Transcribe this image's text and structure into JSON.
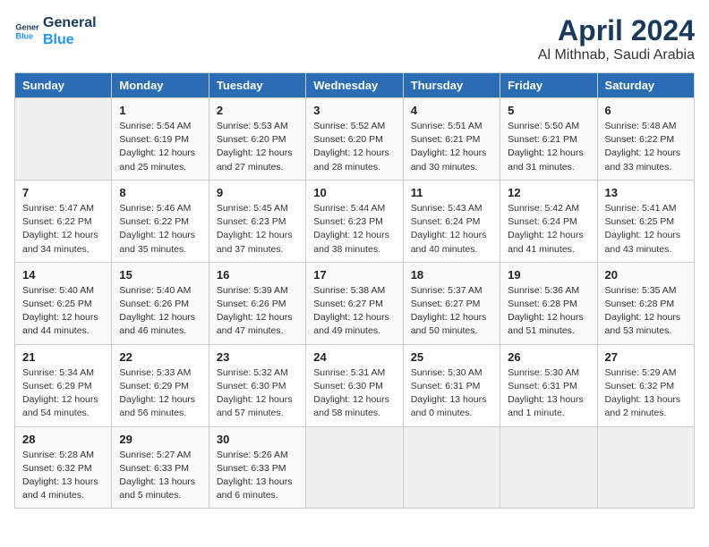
{
  "logo": {
    "line1": "General",
    "line2": "Blue"
  },
  "title": "April 2024",
  "subtitle": "Al Mithnab, Saudi Arabia",
  "headers": [
    "Sunday",
    "Monday",
    "Tuesday",
    "Wednesday",
    "Thursday",
    "Friday",
    "Saturday"
  ],
  "weeks": [
    [
      {
        "day": "",
        "info": ""
      },
      {
        "day": "1",
        "info": "Sunrise: 5:54 AM\nSunset: 6:19 PM\nDaylight: 12 hours\nand 25 minutes."
      },
      {
        "day": "2",
        "info": "Sunrise: 5:53 AM\nSunset: 6:20 PM\nDaylight: 12 hours\nand 27 minutes."
      },
      {
        "day": "3",
        "info": "Sunrise: 5:52 AM\nSunset: 6:20 PM\nDaylight: 12 hours\nand 28 minutes."
      },
      {
        "day": "4",
        "info": "Sunrise: 5:51 AM\nSunset: 6:21 PM\nDaylight: 12 hours\nand 30 minutes."
      },
      {
        "day": "5",
        "info": "Sunrise: 5:50 AM\nSunset: 6:21 PM\nDaylight: 12 hours\nand 31 minutes."
      },
      {
        "day": "6",
        "info": "Sunrise: 5:48 AM\nSunset: 6:22 PM\nDaylight: 12 hours\nand 33 minutes."
      }
    ],
    [
      {
        "day": "7",
        "info": "Sunrise: 5:47 AM\nSunset: 6:22 PM\nDaylight: 12 hours\nand 34 minutes."
      },
      {
        "day": "8",
        "info": "Sunrise: 5:46 AM\nSunset: 6:22 PM\nDaylight: 12 hours\nand 35 minutes."
      },
      {
        "day": "9",
        "info": "Sunrise: 5:45 AM\nSunset: 6:23 PM\nDaylight: 12 hours\nand 37 minutes."
      },
      {
        "day": "10",
        "info": "Sunrise: 5:44 AM\nSunset: 6:23 PM\nDaylight: 12 hours\nand 38 minutes."
      },
      {
        "day": "11",
        "info": "Sunrise: 5:43 AM\nSunset: 6:24 PM\nDaylight: 12 hours\nand 40 minutes."
      },
      {
        "day": "12",
        "info": "Sunrise: 5:42 AM\nSunset: 6:24 PM\nDaylight: 12 hours\nand 41 minutes."
      },
      {
        "day": "13",
        "info": "Sunrise: 5:41 AM\nSunset: 6:25 PM\nDaylight: 12 hours\nand 43 minutes."
      }
    ],
    [
      {
        "day": "14",
        "info": "Sunrise: 5:40 AM\nSunset: 6:25 PM\nDaylight: 12 hours\nand 44 minutes."
      },
      {
        "day": "15",
        "info": "Sunrise: 5:40 AM\nSunset: 6:26 PM\nDaylight: 12 hours\nand 46 minutes."
      },
      {
        "day": "16",
        "info": "Sunrise: 5:39 AM\nSunset: 6:26 PM\nDaylight: 12 hours\nand 47 minutes."
      },
      {
        "day": "17",
        "info": "Sunrise: 5:38 AM\nSunset: 6:27 PM\nDaylight: 12 hours\nand 49 minutes."
      },
      {
        "day": "18",
        "info": "Sunrise: 5:37 AM\nSunset: 6:27 PM\nDaylight: 12 hours\nand 50 minutes."
      },
      {
        "day": "19",
        "info": "Sunrise: 5:36 AM\nSunset: 6:28 PM\nDaylight: 12 hours\nand 51 minutes."
      },
      {
        "day": "20",
        "info": "Sunrise: 5:35 AM\nSunset: 6:28 PM\nDaylight: 12 hours\nand 53 minutes."
      }
    ],
    [
      {
        "day": "21",
        "info": "Sunrise: 5:34 AM\nSunset: 6:29 PM\nDaylight: 12 hours\nand 54 minutes."
      },
      {
        "day": "22",
        "info": "Sunrise: 5:33 AM\nSunset: 6:29 PM\nDaylight: 12 hours\nand 56 minutes."
      },
      {
        "day": "23",
        "info": "Sunrise: 5:32 AM\nSunset: 6:30 PM\nDaylight: 12 hours\nand 57 minutes."
      },
      {
        "day": "24",
        "info": "Sunrise: 5:31 AM\nSunset: 6:30 PM\nDaylight: 12 hours\nand 58 minutes."
      },
      {
        "day": "25",
        "info": "Sunrise: 5:30 AM\nSunset: 6:31 PM\nDaylight: 13 hours\nand 0 minutes."
      },
      {
        "day": "26",
        "info": "Sunrise: 5:30 AM\nSunset: 6:31 PM\nDaylight: 13 hours\nand 1 minute."
      },
      {
        "day": "27",
        "info": "Sunrise: 5:29 AM\nSunset: 6:32 PM\nDaylight: 13 hours\nand 2 minutes."
      }
    ],
    [
      {
        "day": "28",
        "info": "Sunrise: 5:28 AM\nSunset: 6:32 PM\nDaylight: 13 hours\nand 4 minutes."
      },
      {
        "day": "29",
        "info": "Sunrise: 5:27 AM\nSunset: 6:33 PM\nDaylight: 13 hours\nand 5 minutes."
      },
      {
        "day": "30",
        "info": "Sunrise: 5:26 AM\nSunset: 6:33 PM\nDaylight: 13 hours\nand 6 minutes."
      },
      {
        "day": "",
        "info": ""
      },
      {
        "day": "",
        "info": ""
      },
      {
        "day": "",
        "info": ""
      },
      {
        "day": "",
        "info": ""
      }
    ]
  ]
}
